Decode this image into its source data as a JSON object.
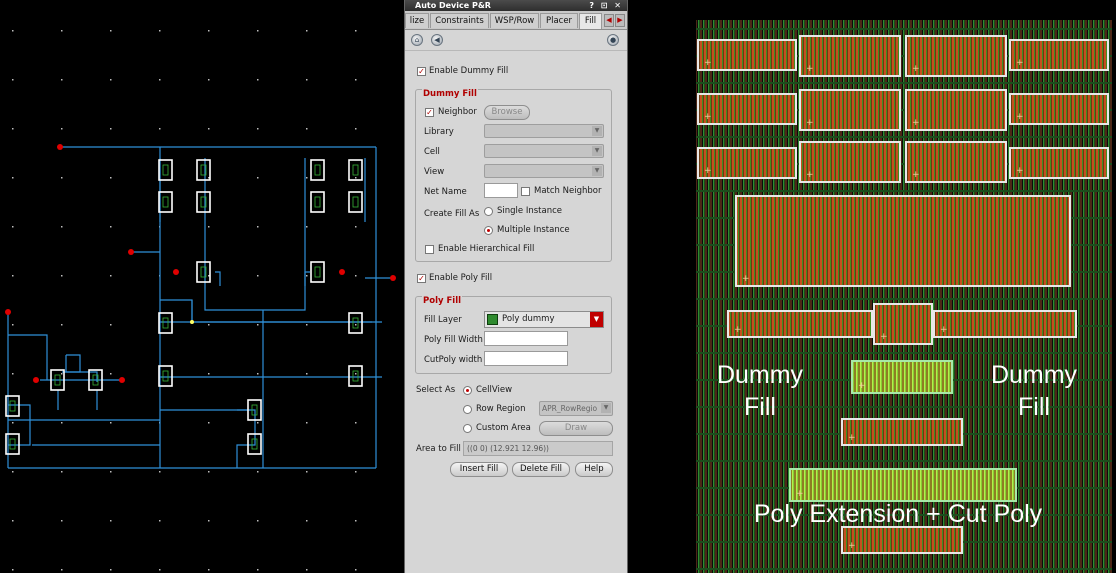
{
  "window": {
    "title": "Auto Device P&R",
    "controls": "? ⊡ ✕"
  },
  "tabs": [
    {
      "label": "lize"
    },
    {
      "label": "Constraints"
    },
    {
      "label": "WSP/Row"
    },
    {
      "label": "Placer"
    },
    {
      "label": "Fill"
    }
  ],
  "active_tab": "Fill",
  "icons": [
    "home-icon",
    "back-icon",
    "help-icon",
    "tab-left-arrow-icon",
    "tab-right-arrow-icon"
  ],
  "form": {
    "enable_dummy_fill": {
      "label": "Enable Dummy Fill",
      "checked": true
    },
    "dummy_fill": {
      "title": "Dummy Fill",
      "neighbor": {
        "label": "Neighbor",
        "checked": true
      },
      "browse_button": "Browse",
      "library_label": "Library",
      "cell_label": "Cell",
      "view_label": "View",
      "net_name_label": "Net Name",
      "match_neighbor": {
        "label": "Match Neighbor",
        "checked": false
      },
      "create_fill_as_label": "Create Fill As",
      "single_instance": {
        "label": "Single Instance",
        "selected": false
      },
      "multiple_instance": {
        "label": "Multiple Instance",
        "selected": true
      },
      "enable_hierarchical_fill": {
        "label": "Enable Hierarchical Fill",
        "checked": false
      }
    },
    "enable_poly_fill": {
      "label": "Enable Poly Fill",
      "checked": true
    },
    "poly_fill": {
      "title": "Poly Fill",
      "fill_layer_label": "Fill Layer",
      "fill_layer_value": "Poly dummy",
      "poly_fill_width_label": "Poly Fill Width",
      "cutpoly_width_label": "CutPoly width"
    },
    "select_as": {
      "label": "Select As",
      "cellview": {
        "label": "CellView",
        "selected": true
      },
      "row_region": {
        "label": "Row Region",
        "selected": false,
        "value": "APR_RowRegio"
      },
      "custom_area": {
        "label": "Custom Area",
        "selected": false
      },
      "draw_button": "Draw"
    },
    "area_to_fill": {
      "label": "Area to Fill",
      "value": "((0 0) (12.921 12.96))"
    },
    "buttons": {
      "insert": "Insert Fill",
      "delete": "Delete Fill",
      "help": "Help"
    }
  },
  "layout_labels": {
    "dummy_fill_left": [
      "Dummy",
      "Fill"
    ],
    "dummy_fill_right": [
      "Dummy",
      "Fill"
    ],
    "poly_extension": "Poly Extension + Cut Poly"
  },
  "colors": {
    "wire": "#2f8fd8",
    "pin": "#e00000",
    "device_box": "#ffffff",
    "poly_red": "#b8331e",
    "fill_green": "#2e8b2e",
    "highlight_outline": "#9fe39f"
  }
}
